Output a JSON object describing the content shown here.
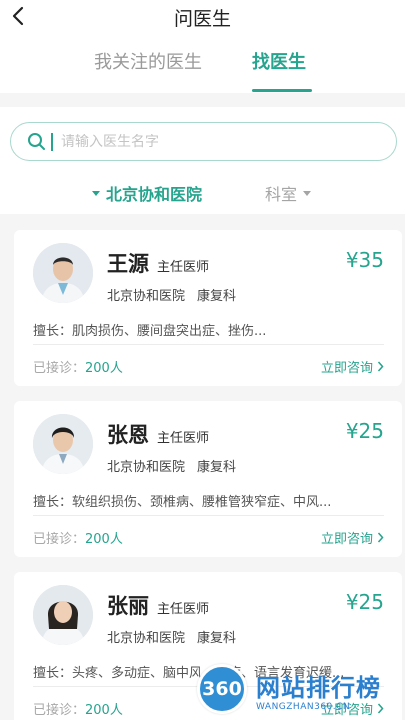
{
  "header": {
    "title": "问医生",
    "tabs": [
      {
        "label": "我关注的医生",
        "active": false
      },
      {
        "label": "找医生",
        "active": true
      }
    ]
  },
  "search": {
    "placeholder": "请输入医生名字",
    "value": ""
  },
  "filters": {
    "hospital": "北京协和医院",
    "department": "科室"
  },
  "doctors": [
    {
      "name": "王源",
      "title": "主任医师",
      "price": "¥35",
      "hospital": "北京协和医院",
      "department": "康复科",
      "specialty": "擅长：肌肉损伤、腰间盘突出症、挫伤...",
      "visits_label": "已接诊：",
      "visits_value": "200人",
      "consult_label": "立即咨询"
    },
    {
      "name": "张恩",
      "title": "主任医师",
      "price": "¥25",
      "hospital": "北京协和医院",
      "department": "康复科",
      "specialty": "擅长：软组织损伤、颈椎病、腰椎管狭窄症、中风...",
      "visits_label": "已接诊：",
      "visits_value": "200人",
      "consult_label": "立即咨询"
    },
    {
      "name": "张丽",
      "title": "主任医师",
      "price": "¥25",
      "hospital": "北京协和医院",
      "department": "康复科",
      "specialty": "擅长：头疼、多动症、脑中风、动症、语言发育迟缓...",
      "visits_label": "已接诊：",
      "visits_value": "200人",
      "consult_label": "立即咨询"
    }
  ],
  "watermark": {
    "logo": "360",
    "text": "网站排行榜",
    "sub": "WANGZHAN360.CN"
  },
  "colors": {
    "accent": "#26a48e",
    "background": "#f5f5f5"
  }
}
